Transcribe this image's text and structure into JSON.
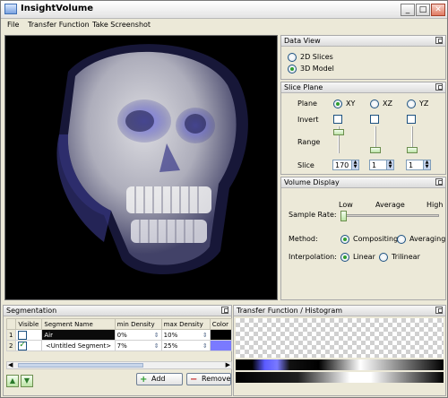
{
  "window": {
    "title": "InsightVolume"
  },
  "menu": [
    "File",
    "Transfer Function",
    "Take Screenshot"
  ],
  "data_view": {
    "header": "Data View",
    "options": [
      {
        "label": "2D Slices",
        "selected": false
      },
      {
        "label": "3D Model",
        "selected": true
      }
    ]
  },
  "slice_plane": {
    "header": "Slice Plane",
    "plane_label": "Plane",
    "invert_label": "Invert",
    "range_label": "Range",
    "slice_label": "Slice",
    "planes": [
      {
        "label": "XY",
        "selected": true,
        "slice": "170",
        "range_level": 0.85
      },
      {
        "label": "XZ",
        "selected": false,
        "slice": "1",
        "range_level": 0.0
      },
      {
        "label": "YZ",
        "selected": false,
        "slice": "1",
        "range_level": 0.0
      }
    ]
  },
  "volume_display": {
    "header": "Volume Display",
    "sample_rate_label": "Sample Rate:",
    "scale": [
      "Low",
      "Average",
      "High"
    ],
    "sample_rate_level": 0.0,
    "method_label": "Method:",
    "methods": [
      {
        "label": "Compositing",
        "selected": true
      },
      {
        "label": "Averaging",
        "selected": false
      }
    ],
    "interp_label": "Interpolation:",
    "interpolations": [
      {
        "label": "Linear",
        "selected": true
      },
      {
        "label": "Trilinear",
        "selected": false
      }
    ]
  },
  "segmentation": {
    "header": "Segmentation",
    "columns": [
      "Visible",
      "Segment Name",
      "min Density",
      "max Density",
      "Color"
    ],
    "rows": [
      {
        "index": "1",
        "visible": false,
        "name": "Air",
        "min": "0%",
        "max": "10%",
        "color": "#000000"
      },
      {
        "index": "2",
        "visible": true,
        "name": "<Untitled Segment>",
        "min": "7%",
        "max": "25%",
        "color": "#7a7aff"
      }
    ],
    "add_label": "Add",
    "remove_label": "Remove",
    "up_icon": "triangle-up-icon",
    "down_icon": "triangle-down-icon"
  },
  "transfer": {
    "header": "Transfer Function / Histogram"
  },
  "colors": {
    "accent": "#2f9e2f",
    "segment_blue": "#7a7aff",
    "background": "#ece9d8"
  }
}
